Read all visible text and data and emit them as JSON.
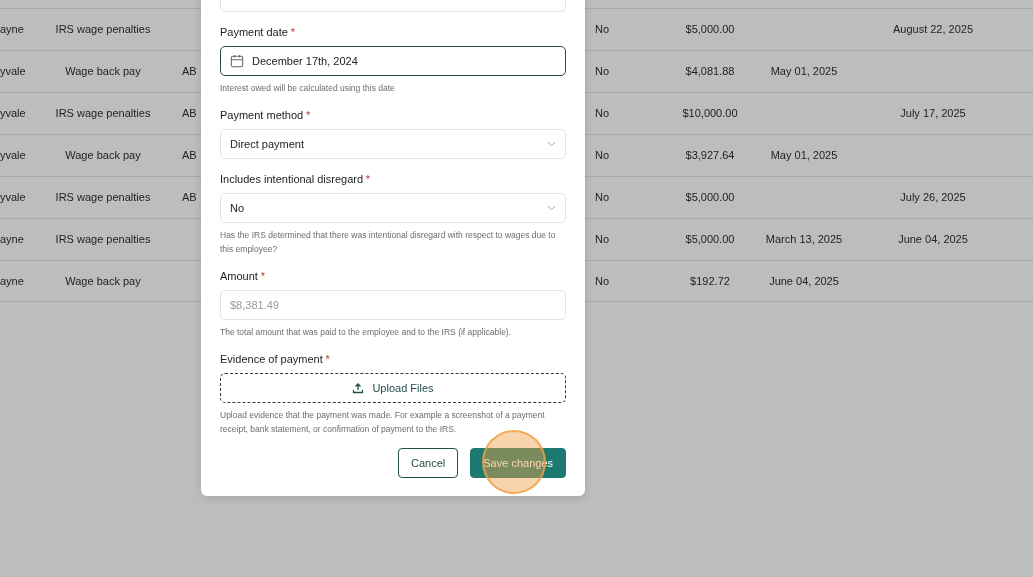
{
  "table": {
    "rows": [
      {
        "column_1": "ayne",
        "column_2": "IRS wage penalties",
        "column_4": "No",
        "column_5": "$5,000.00",
        "column_7": "August 22, 2025"
      },
      {
        "column_1": "yvale",
        "column_2": "Wage back pay",
        "column_3": "AB",
        "column_4": "No",
        "column_5": "$4,081.88",
        "column_6": "May 01, 2025"
      },
      {
        "column_1": "yvale",
        "column_2": "IRS wage penalties",
        "column_3": "AB",
        "column_4": "No",
        "column_5": "$10,000.00",
        "column_7": "July 17, 2025"
      },
      {
        "column_1": "yvale",
        "column_2": "Wage back pay",
        "column_3": "AB",
        "column_4": "No",
        "column_5": "$3,927.64",
        "column_6": "May 01, 2025"
      },
      {
        "column_1": "yvale",
        "column_2": "IRS wage penalties",
        "column_3": "AB",
        "column_4": "No",
        "column_5": "$5,000.00",
        "column_7": "July 26, 2025"
      },
      {
        "column_1": "ayne",
        "column_2": "IRS wage penalties",
        "column_4": "No",
        "column_5": "$5,000.00",
        "column_6": "March 13, 2025",
        "column_7": "June 04, 2025"
      },
      {
        "column_1": "ayne",
        "column_2": "Wage back pay",
        "column_4": "No",
        "column_5": "$192.72",
        "column_6": "June 04, 2025"
      }
    ]
  },
  "modal": {
    "fields": [
      {
        "kind": "blank",
        "focused": false
      },
      {
        "kind": "date",
        "label": "Payment date",
        "required_mark": "*",
        "value": "December 17th, 2024",
        "focused": true,
        "help": "Interest owed will be calculated using this date"
      },
      {
        "kind": "select",
        "label": "Payment method",
        "required_mark": "*",
        "value": "Direct payment",
        "focused": false
      },
      {
        "kind": "select",
        "label": "Includes intentional disregard",
        "required_mark": "*",
        "value": "No",
        "focused": false,
        "help": "Has the IRS determined that there was intentional disregard with respect to wages due to this employee?"
      },
      {
        "kind": "input",
        "label": "Amount",
        "required_mark": "*",
        "placeholder": "$8,381.49",
        "focused": false,
        "help": "The total amount that was paid to the employee and to the IRS (if applicable)."
      },
      {
        "kind": "upload",
        "label": "Evidence of payment",
        "required_mark": "*",
        "value": "Upload Files",
        "focused": false,
        "help": "Upload evidence that the payment was made. For example a screenshot of a payment receipt, bank statement, or confirmation of payment to the IRS."
      }
    ],
    "buttons": [
      {
        "label": "Cancel",
        "kind": "outline",
        "highlighted": false
      },
      {
        "label": "Save changes",
        "kind": "primary",
        "highlighted": true
      }
    ]
  }
}
